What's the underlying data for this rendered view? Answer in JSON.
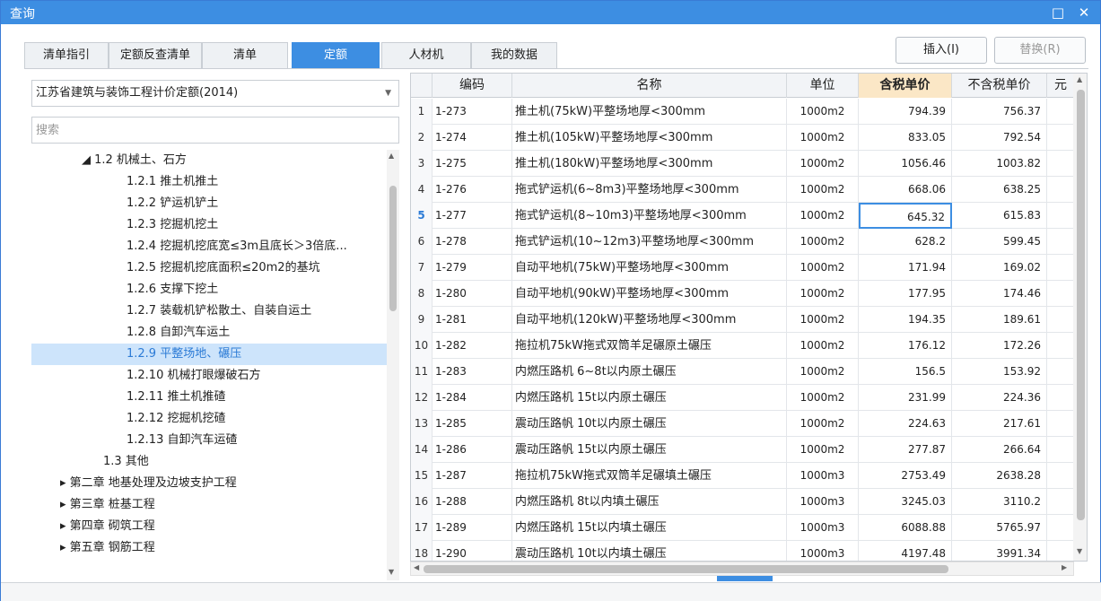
{
  "window": {
    "title": "查询"
  },
  "tabs": [
    {
      "label": "清单指引",
      "active": false
    },
    {
      "label": "定额反查清单",
      "active": false
    },
    {
      "label": "清单",
      "active": false
    },
    {
      "label": "定额",
      "active": true
    },
    {
      "label": "人材机",
      "active": false
    },
    {
      "label": "我的数据",
      "active": false
    }
  ],
  "buttons": {
    "insert": "插入(I)",
    "replace": "替换(R)"
  },
  "library": {
    "selected": "江苏省建筑与装饰工程计价定额(2014)"
  },
  "search": {
    "placeholder": "搜索",
    "value": ""
  },
  "tree": [
    {
      "label": "◢ 1.2 机械土、石方",
      "indent": 1,
      "selected": false
    },
    {
      "label": "1.2.1 推土机推土",
      "indent": 2,
      "selected": false
    },
    {
      "label": "1.2.2 铲运机铲土",
      "indent": 2,
      "selected": false
    },
    {
      "label": "1.2.3 挖掘机挖土",
      "indent": 2,
      "selected": false
    },
    {
      "label": "1.2.4 挖掘机挖底宽≤3m且底长＞3倍底...",
      "indent": 2,
      "selected": false
    },
    {
      "label": "1.2.5 挖掘机挖底面积≤20m2的基坑",
      "indent": 2,
      "selected": false
    },
    {
      "label": "1.2.6 支撑下挖土",
      "indent": 2,
      "selected": false
    },
    {
      "label": "1.2.7 装载机铲松散土、自装自运土",
      "indent": 2,
      "selected": false
    },
    {
      "label": "1.2.8 自卸汽车运土",
      "indent": 2,
      "selected": false
    },
    {
      "label": "1.2.9 平整场地、碾压",
      "indent": 2,
      "selected": true
    },
    {
      "label": "1.2.10 机械打眼爆破石方",
      "indent": 2,
      "selected": false
    },
    {
      "label": "1.2.11 推土机推碴",
      "indent": 2,
      "selected": false
    },
    {
      "label": "1.2.12 挖掘机挖碴",
      "indent": 2,
      "selected": false
    },
    {
      "label": "1.2.13 自卸汽车运碴",
      "indent": 2,
      "selected": false
    },
    {
      "label": "1.3 其他",
      "indent": 1.6,
      "selected": false
    },
    {
      "label": "▸  第二章 地基处理及边坡支护工程",
      "indent": 0,
      "selected": false
    },
    {
      "label": "▸  第三章 桩基工程",
      "indent": 0,
      "selected": false
    },
    {
      "label": "▸  第四章 砌筑工程",
      "indent": 0,
      "selected": false
    },
    {
      "label": "▸  第五章 钢筋工程",
      "indent": 0,
      "selected": false
    }
  ],
  "table": {
    "headers": [
      "",
      "编码",
      "名称",
      "单位",
      "含税单价",
      "不含税单价",
      "元"
    ],
    "current_row": 5,
    "rows": [
      {
        "idx": "1",
        "code": "1-273",
        "name": "推土机(75kW)平整场地厚<300mm",
        "unit": "1000m2",
        "tax": "794.39",
        "notax": "756.37"
      },
      {
        "idx": "2",
        "code": "1-274",
        "name": "推土机(105kW)平整场地厚<300mm",
        "unit": "1000m2",
        "tax": "833.05",
        "notax": "792.54"
      },
      {
        "idx": "3",
        "code": "1-275",
        "name": "推土机(180kW)平整场地厚<300mm",
        "unit": "1000m2",
        "tax": "1056.46",
        "notax": "1003.82"
      },
      {
        "idx": "4",
        "code": "1-276",
        "name": "拖式铲运机(6~8m3)平整场地厚<300mm",
        "unit": "1000m2",
        "tax": "668.06",
        "notax": "638.25"
      },
      {
        "idx": "5",
        "code": "1-277",
        "name": "拖式铲运机(8~10m3)平整场地厚<300mm",
        "unit": "1000m2",
        "tax": "645.32",
        "notax": "615.83"
      },
      {
        "idx": "6",
        "code": "1-278",
        "name": "拖式铲运机(10~12m3)平整场地厚<300mm",
        "unit": "1000m2",
        "tax": "628.2",
        "notax": "599.45"
      },
      {
        "idx": "7",
        "code": "1-279",
        "name": "自动平地机(75kW)平整场地厚<300mm",
        "unit": "1000m2",
        "tax": "171.94",
        "notax": "169.02"
      },
      {
        "idx": "8",
        "code": "1-280",
        "name": "自动平地机(90kW)平整场地厚<300mm",
        "unit": "1000m2",
        "tax": "177.95",
        "notax": "174.46"
      },
      {
        "idx": "9",
        "code": "1-281",
        "name": "自动平地机(120kW)平整场地厚<300mm",
        "unit": "1000m2",
        "tax": "194.35",
        "notax": "189.61"
      },
      {
        "idx": "10",
        "code": "1-282",
        "name": "拖拉机75kW拖式双筒羊足碾原土碾压",
        "unit": "1000m2",
        "tax": "176.12",
        "notax": "172.26"
      },
      {
        "idx": "11",
        "code": "1-283",
        "name": "内燃压路机 6~8t以内原土碾压",
        "unit": "1000m2",
        "tax": "156.5",
        "notax": "153.92"
      },
      {
        "idx": "12",
        "code": "1-284",
        "name": "内燃压路机 15t以内原土碾压",
        "unit": "1000m2",
        "tax": "231.99",
        "notax": "224.36"
      },
      {
        "idx": "13",
        "code": "1-285",
        "name": "震动压路帆 10t以内原土碾压",
        "unit": "1000m2",
        "tax": "224.63",
        "notax": "217.61"
      },
      {
        "idx": "14",
        "code": "1-286",
        "name": "震动压路帆 15t以内原土碾压",
        "unit": "1000m2",
        "tax": "277.87",
        "notax": "266.64"
      },
      {
        "idx": "15",
        "code": "1-287",
        "name": "拖拉机75kW拖式双筒羊足碾填土碾压",
        "unit": "1000m3",
        "tax": "2753.49",
        "notax": "2638.28"
      },
      {
        "idx": "16",
        "code": "1-288",
        "name": "内燃压路机 8t以内填土碾压",
        "unit": "1000m3",
        "tax": "3245.03",
        "notax": "3110.2"
      },
      {
        "idx": "17",
        "code": "1-289",
        "name": "内燃压路机 15t以内填土碾压",
        "unit": "1000m3",
        "tax": "6088.88",
        "notax": "5765.97"
      },
      {
        "idx": "18",
        "code": "1-290",
        "name": "震动压路机 10t以内填土碾压",
        "unit": "1000m3",
        "tax": "4197.48",
        "notax": "3991.34"
      }
    ]
  },
  "icons": {
    "maximize": "maximize-icon",
    "close": "close-icon",
    "dropdown": "chevron-down-icon"
  },
  "colors": {
    "accent": "#3d8ee2",
    "header_highlight": "#fbe7c6",
    "selection": "#cde4fb"
  }
}
